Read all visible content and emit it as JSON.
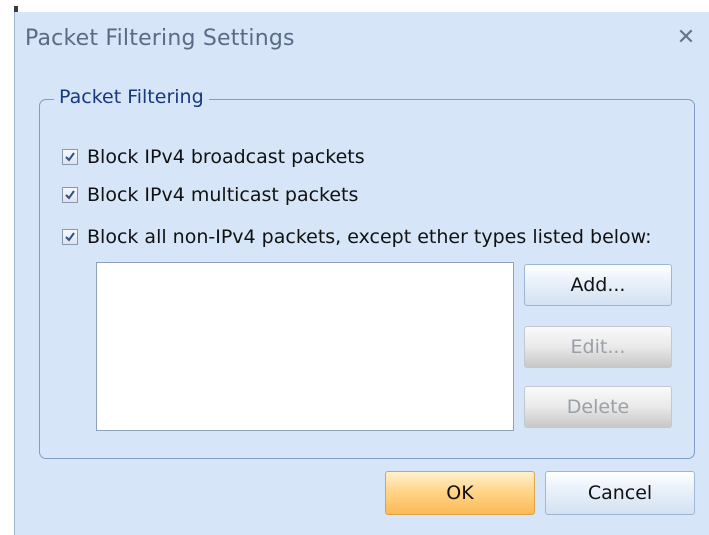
{
  "window": {
    "title": "Packet Filtering Settings",
    "close_icon": "close-icon"
  },
  "group": {
    "legend": "Packet Filtering",
    "checkboxes": [
      {
        "label": "Block IPv4 broadcast packets",
        "checked": true
      },
      {
        "label": "Block IPv4 multicast packets",
        "checked": true
      },
      {
        "label": "Block all non-IPv4 packets, except ether types listed below:",
        "checked": true
      }
    ],
    "list_items": []
  },
  "buttons": {
    "add": "Add...",
    "edit": "Edit...",
    "delete": "Delete",
    "ok": "OK",
    "cancel": "Cancel"
  },
  "colors": {
    "dialog_background": "#d6e6f8",
    "title_text": "#5b6a85",
    "group_legend_text": "#17397f",
    "ok_button_accent": "#fbb955",
    "disabled_text": "#9aa0a8"
  }
}
